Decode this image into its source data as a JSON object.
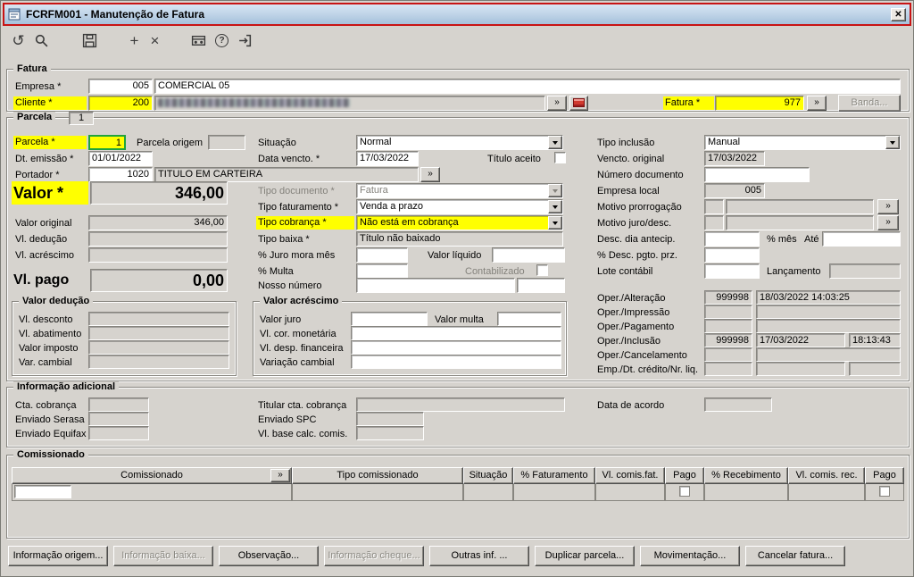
{
  "window": {
    "title": "FCRFM001 - Manutenção de Fatura",
    "close_glyph": "✕"
  },
  "glyphs": {
    "lookup": "»",
    "undo": "↺",
    "add": "+",
    "delete": "×",
    "help": "?"
  },
  "toolbar": {
    "icons": [
      "undo-icon",
      "search-icon",
      "save-icon",
      "add-icon",
      "delete-icon",
      "browse-icon",
      "help-icon",
      "exit-icon"
    ]
  },
  "fatura": {
    "legend": "Fatura",
    "empresa_label": "Empresa *",
    "empresa_code": "005",
    "empresa_name": "COMERCIAL 05",
    "cliente_label": "Cliente *",
    "cliente_code": "200",
    "fatura_label": "Fatura *",
    "fatura_value": "977",
    "banda_button": "Banda..."
  },
  "parcela": {
    "legend": "Parcela",
    "record_counter": "1",
    "parcela_label": "Parcela *",
    "parcela_value": "1",
    "parcela_origem_label": "Parcela origem",
    "situacao_label": "Situação",
    "situacao_value": "Normal",
    "tipo_inclusao_label": "Tipo inclusão",
    "tipo_inclusao_value": "Manual",
    "dt_emissao_label": "Dt. emissão *",
    "dt_emissao_value": "01/01/2022",
    "data_vencto_label": "Data vencto. *",
    "data_vencto_value": "17/03/2022",
    "titulo_aceito_label": "Título aceito",
    "vencto_original_label": "Vencto. original",
    "vencto_original_value": "17/03/2022",
    "portador_label": "Portador *",
    "portador_code": "1020",
    "portador_name": "TITULO EM CARTEIRA",
    "numero_documento_label": "Número documento",
    "valor_label": "Valor *",
    "valor_value": "346,00",
    "tipo_documento_label": "Tipo documento *",
    "tipo_documento_value": "Fatura",
    "empresa_local_label": "Empresa local",
    "empresa_local_value": "005",
    "tipo_faturamento_label": "Tipo faturamento *",
    "tipo_faturamento_value": "Venda a prazo",
    "motivo_prorrogacao_label": "Motivo prorrogação",
    "valor_original_label": "Valor original",
    "valor_original_value": "346,00",
    "tipo_cobranca_label": "Tipo cobrança *",
    "tipo_cobranca_value": "Não está em cobrança",
    "motivo_juro_label": "Motivo juro/desc.",
    "vl_deducao_label": "Vl. dedução",
    "tipo_baixa_label": "Tipo baixa *",
    "tipo_baixa_value": "Título não baixado",
    "desc_dia_label": "Desc. dia antecip.",
    "pct_mes_label": "% mês",
    "ate_label": "Até",
    "vl_acrescimo_label": "Vl. acréscimo",
    "juro_mora_label": "% Juro mora mês",
    "valor_liquido_label": "Valor líquido",
    "desc_pgto_label": "% Desc. pgto. prz.",
    "multa_label": "% Multa",
    "contabilizado_label": "Contabilizado",
    "lote_contabil_label": "Lote contábil",
    "lancamento_label": "Lançamento",
    "vl_pago_label": "Vl. pago",
    "vl_pago_value": "0,00",
    "nosso_numero_label": "Nosso número",
    "oper_alteracao_label": "Oper./Alteração",
    "oper_alteracao_code": "999998",
    "oper_alteracao_datetime": "18/03/2022 14:03:25",
    "oper_impressao_label": "Oper./Impressão",
    "oper_pagamento_label": "Oper./Pagamento",
    "oper_inclusao_label": "Oper./Inclusão",
    "oper_inclusao_code": "999998",
    "oper_inclusao_date": "17/03/2022",
    "oper_inclusao_time": "18:13:43",
    "oper_cancelamento_label": "Oper./Cancelamento",
    "emp_dt_credito_label": "Emp./Dt. crédito/Nr. liq."
  },
  "valor_deducao": {
    "legend": "Valor dedução",
    "vl_desconto_label": "Vl. desconto",
    "vl_abatimento_label": "Vl. abatimento",
    "valor_imposto_label": "Valor imposto",
    "var_cambial_label": "Var. cambial"
  },
  "valor_acrescimo": {
    "legend": "Valor acréscimo",
    "valor_juro_label": "Valor juro",
    "valor_multa_label": "Valor multa",
    "vl_cor_monetaria_label": "Vl. cor. monetária",
    "vl_desp_financeira_label": "Vl. desp. financeira",
    "variacao_cambial_label": "Variação cambial"
  },
  "info_adicional": {
    "legend": "Informação adicional",
    "cta_cobranca_label": "Cta. cobrança",
    "titular_label": "Titular cta. cobrança",
    "data_acordo_label": "Data de acordo",
    "enviado_serasa_label": "Enviado Serasa",
    "enviado_spc_label": "Enviado SPC",
    "enviado_equifax_label": "Enviado Equifax",
    "vl_base_label": "Vl. base calc. comis."
  },
  "comissionado": {
    "legend": "Comissionado",
    "headers": [
      "Comissionado",
      "Tipo comissionado",
      "Situação",
      "% Faturamento",
      "Vl. comis.fat.",
      "Pago",
      "% Recebimento",
      "Vl. comis. rec.",
      "Pago"
    ]
  },
  "footer_buttons": [
    {
      "label": "Informação origem..."
    },
    {
      "label": "Informação baixa..."
    },
    {
      "label": "Observação..."
    },
    {
      "label": "Informação cheque..."
    },
    {
      "label": "Outras inf. ..."
    },
    {
      "label": "Duplicar parcela..."
    },
    {
      "label": "Movimentação..."
    },
    {
      "label": "Cancelar fatura..."
    }
  ],
  "colors": {
    "required_highlight": "#ffff00",
    "annotation_border": "#c81414",
    "parcela_field_border": "#1fa33c"
  }
}
